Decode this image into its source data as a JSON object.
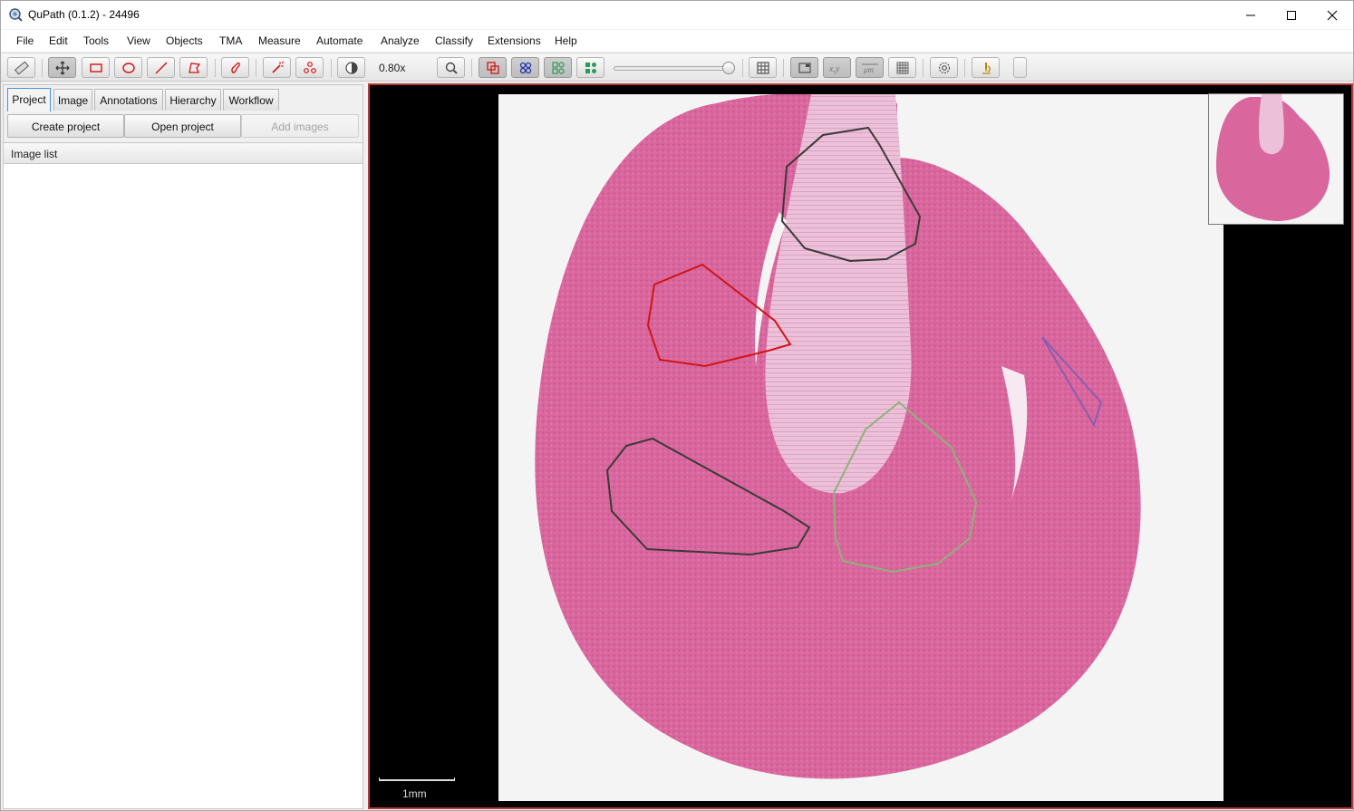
{
  "window": {
    "title": "QuPath (0.1.2) - 24496",
    "minimize_icon": "minimize-icon",
    "maximize_icon": "maximize-icon",
    "close_icon": "close-icon"
  },
  "menu": [
    "File",
    "Edit",
    "Tools",
    "View",
    "Objects",
    "TMA",
    "Measure",
    "Automate",
    "Analyze",
    "Classify",
    "Extensions",
    "Help"
  ],
  "toolbar": {
    "zoom_label": "0.80x",
    "opacity_slider_value": 1.0,
    "tools": [
      "measure-ruler-icon",
      "move-icon",
      "rectangle-icon",
      "ellipse-icon",
      "line-icon",
      "polygon-icon",
      "brush-icon",
      "wand-icon",
      "points-icon",
      "brightness-contrast-icon",
      "zoom-to-fit-icon",
      "show-annotations-icon",
      "show-tma-grid-icon",
      "show-detections-icon",
      "fill-detections-icon",
      "measurement-table-icon",
      "overview-icon",
      "cursor-location-icon",
      "scalebar-icon",
      "grid-icon",
      "preferences-icon",
      "microscope-icon"
    ]
  },
  "left_panel": {
    "tabs": [
      "Project",
      "Image",
      "Annotations",
      "Hierarchy",
      "Workflow"
    ],
    "active_tab": "Project",
    "buttons": {
      "create": "Create project",
      "open": "Open project",
      "add": "Add images"
    },
    "list_header": "Image list"
  },
  "viewer": {
    "scalebar_label": "1mm",
    "annotation_colors": {
      "dark": "#3a3a3a",
      "red": "#d11414",
      "green": "#8fb27a",
      "purple": "#8a5cb0"
    }
  }
}
